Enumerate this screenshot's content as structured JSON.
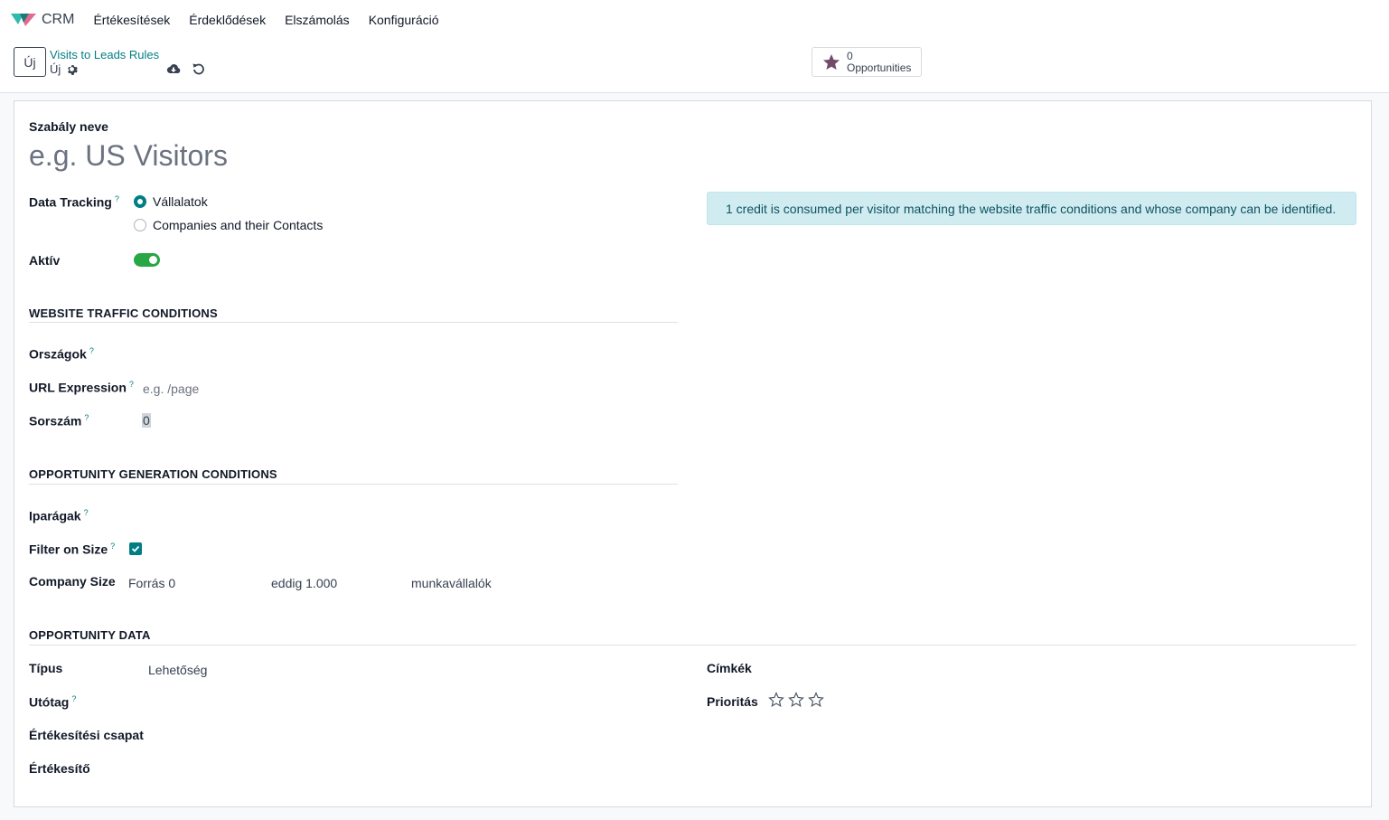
{
  "navbar": {
    "app_name": "CRM",
    "menu": [
      "Értékesítések",
      "Érdeklődések",
      "Elszámolás",
      "Konfiguráció"
    ]
  },
  "control_panel": {
    "new_button": "Új",
    "breadcrumb_parent": "Visits to Leads Rules",
    "breadcrumb_current": "Új",
    "smart_button": {
      "count": "0",
      "label": "Opportunities"
    }
  },
  "form": {
    "name_label": "Szabály neve",
    "name_placeholder": "e.g. US Visitors",
    "data_tracking": {
      "label": "Data Tracking",
      "options": [
        "Vállalatok",
        "Companies and their Contacts"
      ],
      "selected": "Vállalatok"
    },
    "active": {
      "label": "Aktív",
      "value": true
    },
    "info_alert": "1 credit is consumed per visitor matching the website traffic conditions and whose company can be identified.",
    "traffic_section": {
      "title": "WEBSITE TRAFFIC CONDITIONS",
      "countries_label": "Országok",
      "url_label": "URL Expression",
      "url_placeholder": "e.g. /page",
      "sequence_label": "Sorszám",
      "sequence_value": "0"
    },
    "opportunity_section": {
      "title": "OPPORTUNITY GENERATION CONDITIONS",
      "industries_label": "Iparágak",
      "filter_size_label": "Filter on Size",
      "filter_size_checked": true,
      "company_size_label": "Company Size",
      "size_from": "Forrás 0",
      "size_to": "eddig 1.000",
      "size_unit": "munkavállalók"
    },
    "data_section": {
      "title": "OPPORTUNITY DATA",
      "type_label": "Típus",
      "type_value": "Lehetőség",
      "suffix_label": "Utótag",
      "team_label": "Értékesítési csapat",
      "salesperson_label": "Értékesítő",
      "tags_label": "Címkék",
      "priority_label": "Prioritás",
      "priority_stars": 3,
      "priority_value": 0
    }
  },
  "colors": {
    "brand": "#017e84",
    "toggle_on": "#28a745",
    "star_smart": "#714b67"
  }
}
